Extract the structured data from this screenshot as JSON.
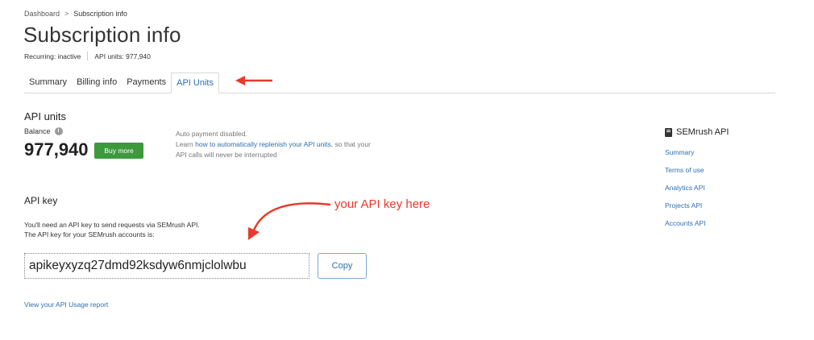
{
  "breadcrumb": {
    "items": [
      "Dashboard",
      "Subscription info"
    ],
    "separator": ">"
  },
  "page": {
    "title": "Subscription info",
    "recurring": "Recurring: inactive",
    "api_units_meta": "API units: 977,940"
  },
  "tabs": [
    {
      "label": "Summary",
      "active": false
    },
    {
      "label": "Billing info",
      "active": false
    },
    {
      "label": "Payments",
      "active": false
    },
    {
      "label": "API Units",
      "active": true
    }
  ],
  "api_units": {
    "section_title": "API units",
    "balance_label": "Balance",
    "balance_value": "977,940",
    "buy_more_label": "Buy more",
    "autopay_line1": "Auto payment disabled.",
    "autopay_learn": "Learn",
    "autopay_link": "how to automatically replenish your API units",
    "autopay_rest": ", so that your",
    "autopay_line3": "API calls will never be interrupted"
  },
  "sidebar": {
    "title": "SEMrush API",
    "links": [
      "Summary",
      "Terms of use",
      "Analytics API",
      "Projects API",
      "Accounts API"
    ]
  },
  "api_key": {
    "title": "API key",
    "desc_line1": "You'll need an API key to send requests via SEMrush API.",
    "desc_line2": "The API key for your SEMrush accounts is:",
    "value": "apikeyxyzq27dmd92ksdyw6nmjclolwbu",
    "copy_label": "Copy",
    "annotation": "your API key here"
  },
  "usage_link": "View your API Usage report",
  "colors": {
    "accent": "#2e6fb0",
    "buy_green": "#3c9a3c",
    "annotation_red": "#e8392b"
  }
}
